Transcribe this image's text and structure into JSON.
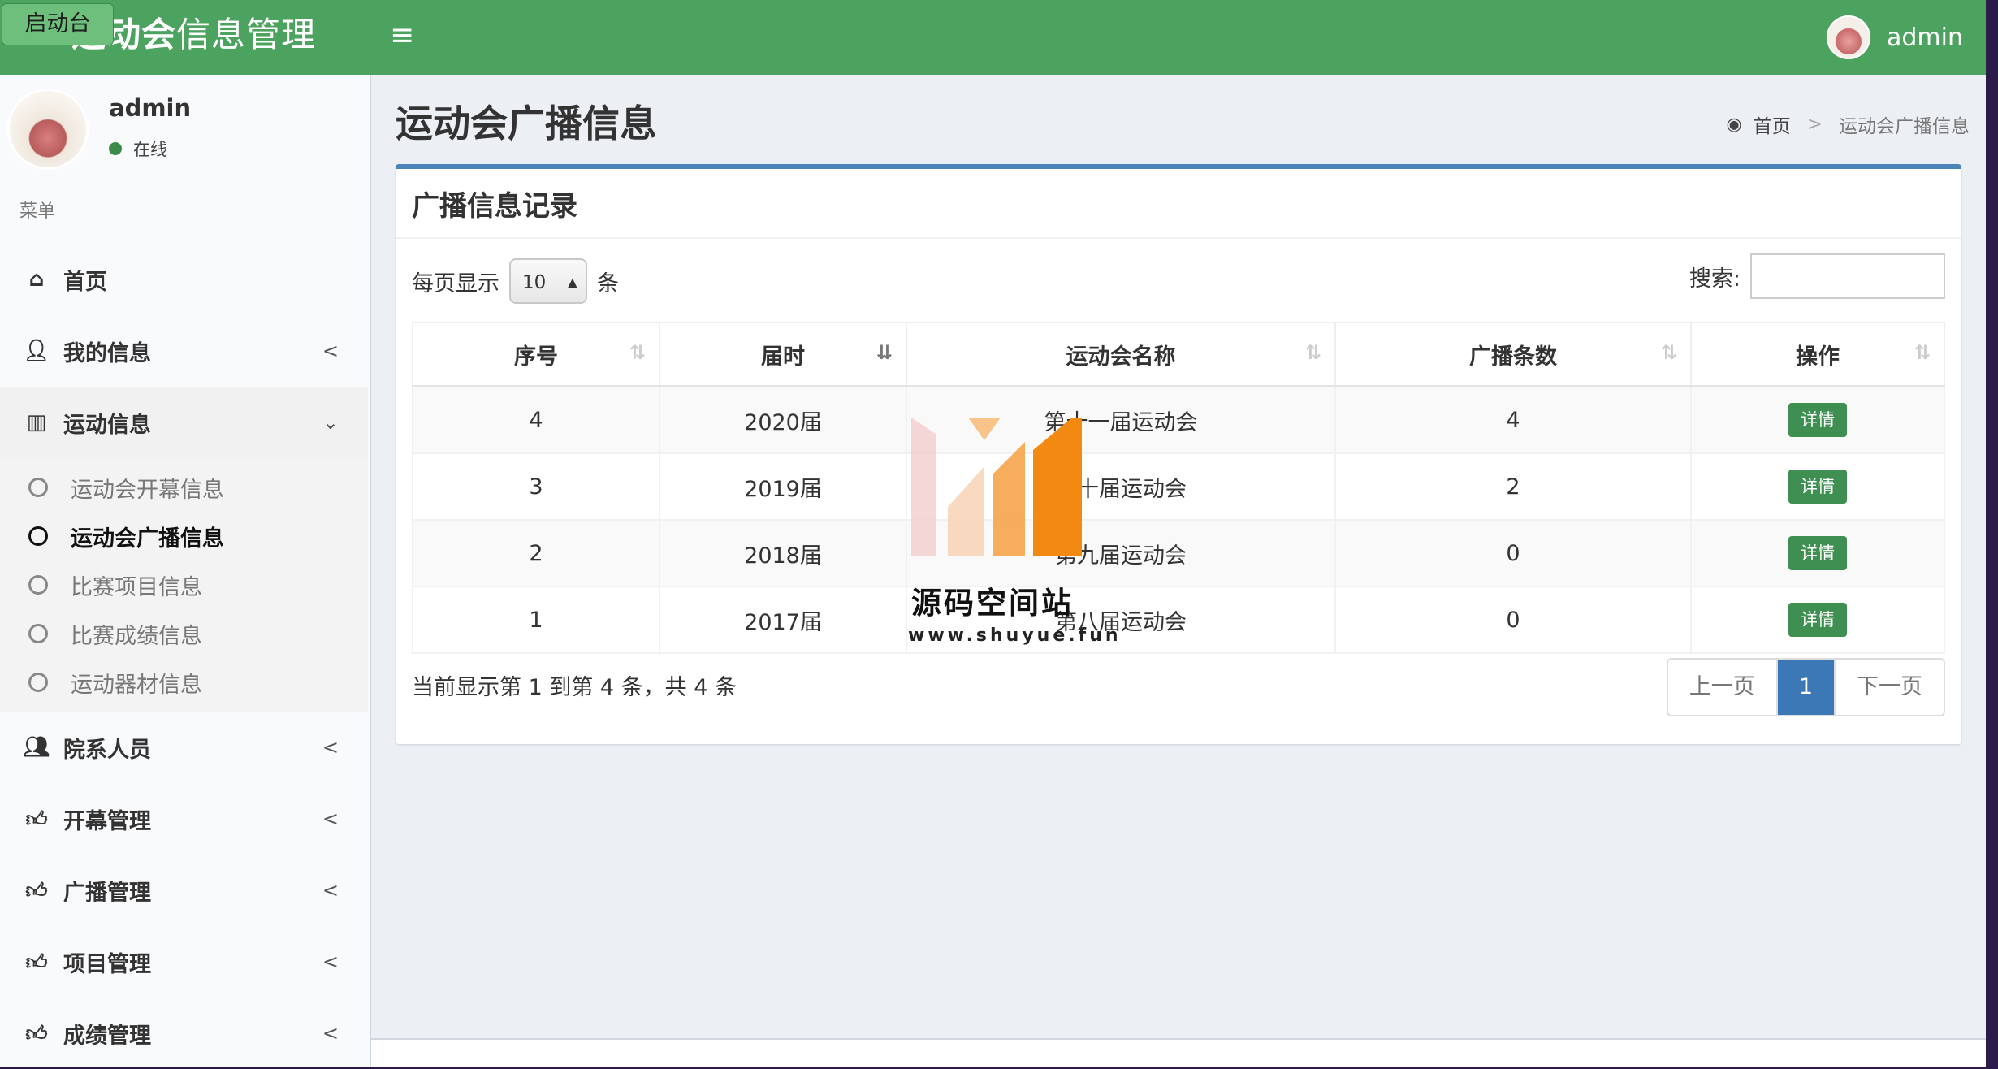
{
  "header": {
    "logo_bold": "运动会",
    "logo_rest": "信息管理",
    "launch_label": "启动台",
    "toggle_icon": "bars-icon",
    "user_name": "admin"
  },
  "sidebar": {
    "user_name": "admin",
    "status": "在线",
    "menu_header": "菜单",
    "items": [
      {
        "label": "首页",
        "icon": "home-icon"
      },
      {
        "label": "我的信息",
        "icon": "user-icon"
      },
      {
        "label": "运动信息",
        "icon": "bar-chart-icon"
      },
      {
        "label": "院系人员",
        "icon": "users-icon"
      },
      {
        "label": "开幕管理",
        "icon": "thumbs-up-icon"
      },
      {
        "label": "广播管理",
        "icon": "thumbs-up-icon"
      },
      {
        "label": "项目管理",
        "icon": "thumbs-up-icon"
      },
      {
        "label": "成绩管理",
        "icon": "thumbs-up-icon"
      }
    ],
    "sub_items": [
      "运动会开幕信息",
      "运动会广播信息",
      "比赛项目信息",
      "比赛成绩信息",
      "运动器材信息"
    ]
  },
  "content": {
    "page_title": "运动会广播信息",
    "breadcrumb_home": "首页",
    "breadcrumb_sep": ">",
    "breadcrumb_current": "运动会广播信息",
    "box_title": "广播信息记录",
    "length_prefix": "每页显示",
    "length_value": "10",
    "length_suffix": "条",
    "search_label": "搜索:",
    "columns": [
      "序号",
      "届时",
      "运动会名称",
      "广播条数",
      "操作"
    ],
    "rows": [
      {
        "id": "4",
        "year": "2020届",
        "name": "第十一届运动会",
        "count": "4",
        "action": "详情"
      },
      {
        "id": "3",
        "year": "2019届",
        "name": "第十届运动会",
        "count": "2",
        "action": "详情"
      },
      {
        "id": "2",
        "year": "2018届",
        "name": "第九届运动会",
        "count": "0",
        "action": "详情"
      },
      {
        "id": "1",
        "year": "2017届",
        "name": "第八届运动会",
        "count": "0",
        "action": "详情"
      }
    ],
    "info": "当前显示第 1 到第 4 条，共 4 条",
    "pager": {
      "prev": "上一页",
      "current": "1",
      "next": "下一页"
    }
  },
  "watermark": {
    "text": "源码空间站",
    "url": "www.shuyue.fun"
  },
  "colors": {
    "header_bg": "#4ba35f",
    "box_top": "#4a84b8",
    "button_green": "#3f8f52",
    "pager_active": "#3c78b5"
  }
}
